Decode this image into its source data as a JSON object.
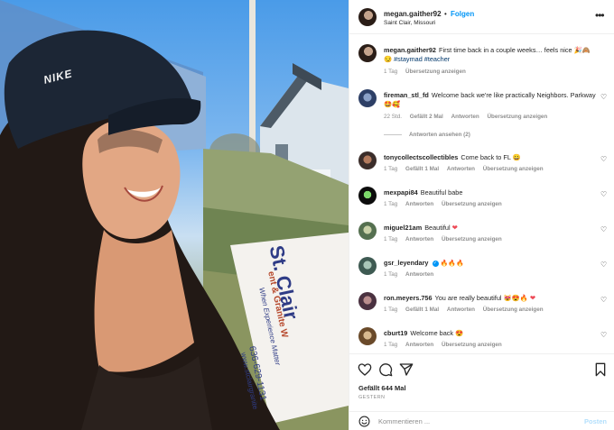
{
  "photo": {
    "cap_brand": "NIKE",
    "sign": {
      "line1": "St. Clair",
      "line2": "ent & Granite W",
      "line3": "When Experience Matter",
      "line4": "636-629-1131",
      "line5": "www.stclairgranite"
    }
  },
  "header": {
    "username": "megan.gaither92",
    "separator": "•",
    "follow_label": "Folgen",
    "location": "Saint Clair, Missouri",
    "more_icon": "more-horizontal-icon"
  },
  "caption": {
    "username": "megan.gaither92",
    "text": "First time back in a couple weeks… feels nice 🎉🙈😏",
    "hashtags": "#staymad #teacher",
    "meta": {
      "time": "1 Tag",
      "translate": "Übersetzung anzeigen"
    }
  },
  "comments": [
    {
      "username": "fireman_stl_fd",
      "text": "Welcome back we're like practically Neighbors. Parkway 🤩🥰",
      "time": "22 Std.",
      "likes": "Gefällt 2 Mal",
      "reply": "Antworten",
      "translate": "Übersetzung anzeigen",
      "view_replies": "Antworten ansehen (2)"
    },
    {
      "username": "tonycollectscollectibles",
      "text": "Come back to FL 😀",
      "time": "1 Tag",
      "likes": "Gefällt 1 Mal",
      "reply": "Antworten",
      "translate": "Übersetzung anzeigen"
    },
    {
      "username": "mexpapi84",
      "text": "Beautiful babe",
      "time": "1 Tag",
      "reply": "Antworten",
      "translate": "Übersetzung anzeigen"
    },
    {
      "username": "miguel21am",
      "text": "Beautiful",
      "emoji": "❤",
      "time": "1 Tag",
      "reply": "Antworten",
      "translate": "Übersetzung anzeigen"
    },
    {
      "username": "gsr_leyendary",
      "text": "🔥🔥🔥",
      "time": "1 Tag",
      "reply": "Antworten"
    },
    {
      "username": "ron.meyers.756",
      "text": "You are really beautiful 😻😍🔥",
      "emoji": "❤",
      "time": "1 Tag",
      "likes": "Gefällt 1 Mal",
      "reply": "Antworten",
      "translate": "Übersetzung anzeigen"
    },
    {
      "username": "cburt19",
      "text": "Welcome back 😍",
      "time": "1 Tag",
      "reply": "Antworten",
      "translate": "Übersetzung anzeigen"
    }
  ],
  "actions": {
    "likes": "Gefällt 644 Mal",
    "date": "GESTERN"
  },
  "composer": {
    "placeholder": "Kommentieren ...",
    "post_label": "Posten"
  },
  "colors": {
    "accent": "#0095f6",
    "muted": "#8e8e8e",
    "text": "#262626",
    "post_disabled": "#b2dffc"
  }
}
